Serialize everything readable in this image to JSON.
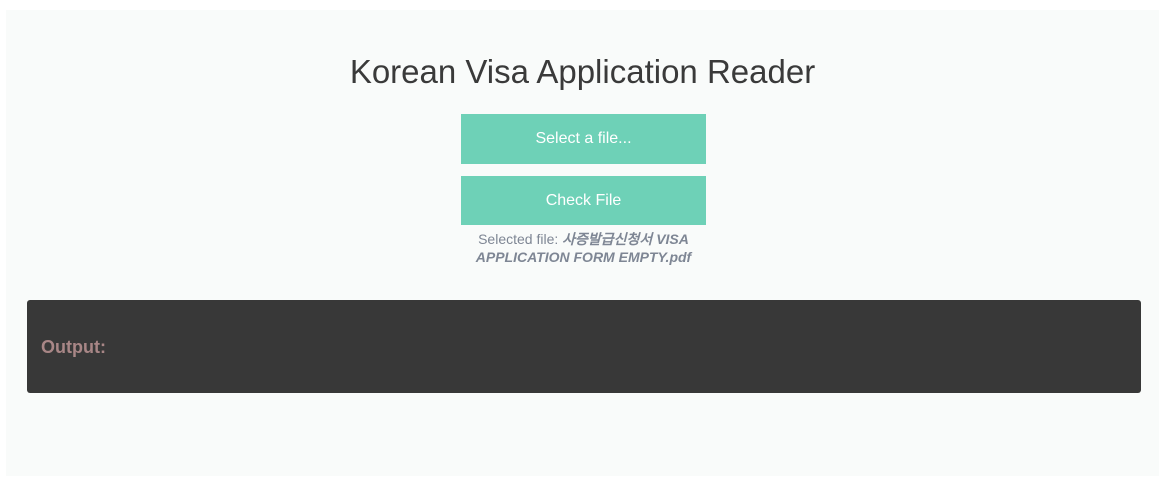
{
  "page": {
    "title": "Korean Visa Application Reader"
  },
  "buttons": {
    "select_label": "Select a file...",
    "check_label": "Check File"
  },
  "selected_file": {
    "prefix": "Selected file: ",
    "name": "사증발급신청서 VISA APPLICATION FORM EMPTY.pdf"
  },
  "output": {
    "label": "Output:"
  },
  "colors": {
    "accent": "#6ed1b7",
    "output_bg": "#383838",
    "output_label": "#a88686"
  }
}
